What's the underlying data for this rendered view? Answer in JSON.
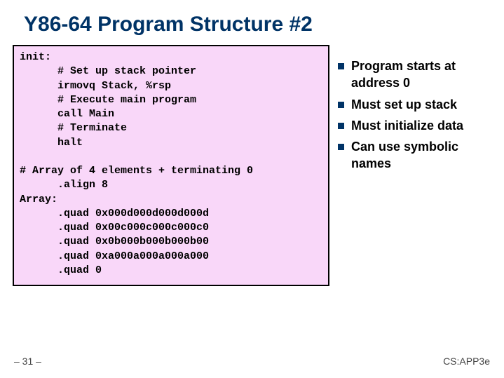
{
  "title": "Y86-64 Program Structure #2",
  "code": "init:\n      # Set up stack pointer\n      irmovq Stack, %rsp\n      # Execute main program\n      call Main\n      # Terminate\n      halt\n\n# Array of 4 elements + terminating 0\n      .align 8\nArray:\n      .quad 0x000d000d000d000d\n      .quad 0x00c000c000c000c0\n      .quad 0x0b000b000b000b00\n      .quad 0xa000a000a000a000\n      .quad 0",
  "bullets": [
    "Program starts at address 0",
    "Must set up stack",
    "Must initialize data",
    "Can use symbolic names"
  ],
  "footer": {
    "left": "– 31 –",
    "right": "CS:APP3e"
  }
}
